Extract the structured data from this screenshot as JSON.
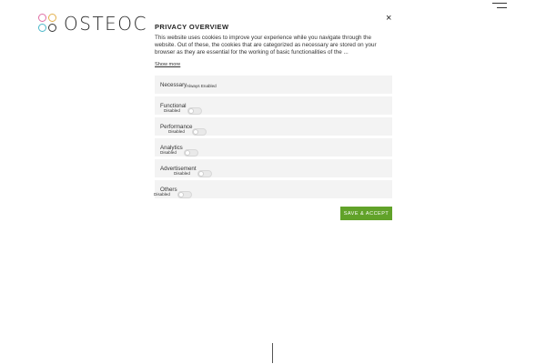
{
  "site": {
    "logo_text": "OSTEOCLINI",
    "logo_colors": [
      "#e06fa5",
      "#e3b04b",
      "#4bb7c9",
      "#5aa46a",
      "#333333",
      "#333333"
    ]
  },
  "modal": {
    "title": "PRIVACY OVERVIEW",
    "description": "This website uses cookies to improve your experience while you navigate through the website. Out of these, the cookies that are categorized as necessary are stored on your browser as they are essential for the working of basic functionalities of the ...",
    "show_more": "Show more",
    "close_symbol": "×",
    "categories": [
      {
        "name": "Necessary",
        "status": "Always Enabled"
      },
      {
        "name": "Functional",
        "status": "Disabled"
      },
      {
        "name": "Performance",
        "status": "Disabled"
      },
      {
        "name": "Analytics",
        "status": "Disabled"
      },
      {
        "name": "Advertisement",
        "status": "Disabled"
      },
      {
        "name": "Others",
        "status": "Disabled"
      }
    ],
    "save_label": "SAVE & ACCEPT",
    "accent_color": "#61a229"
  }
}
